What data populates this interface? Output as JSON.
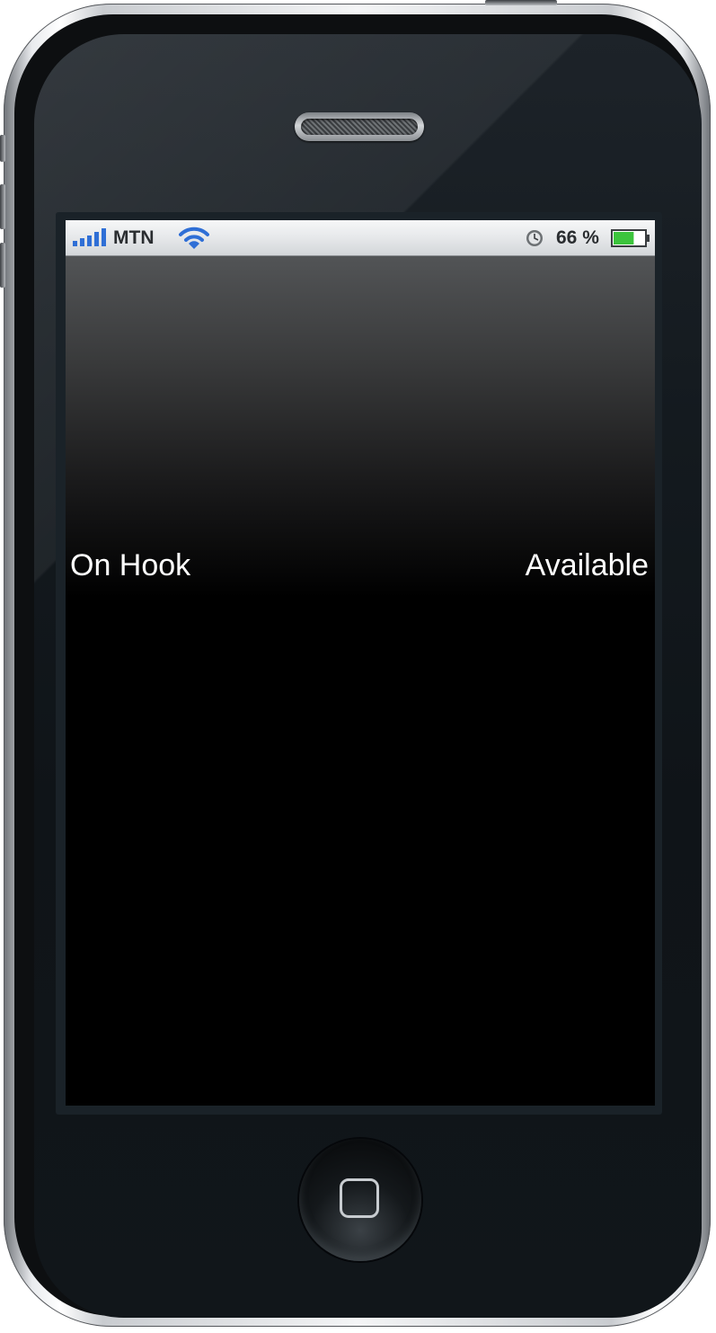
{
  "status_bar": {
    "carrier": "MTN",
    "battery_percent": "66 %",
    "battery_level": 0.66,
    "signal_bars": 5,
    "icons": {
      "signal": "signal-strength-icon",
      "wifi": "wifi-icon",
      "clock": "clock-icon",
      "battery": "battery-icon"
    },
    "colors": {
      "signal": "#2f6fd6",
      "wifi": "#2f6fd6",
      "battery_fill": "#3cc43c"
    }
  },
  "main": {
    "hook_status": "On Hook",
    "availability": "Available"
  },
  "device": {
    "home_button_icon": "home-square-icon",
    "earpiece": "earpiece-speaker"
  }
}
